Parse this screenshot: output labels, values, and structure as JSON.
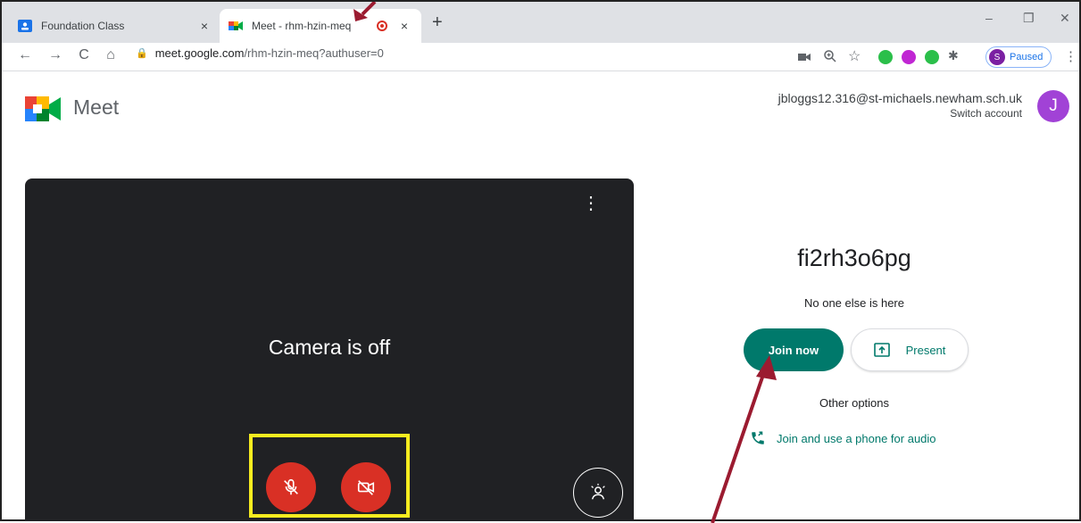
{
  "browser": {
    "tabs": [
      {
        "title": "Foundation Class",
        "close": "×"
      },
      {
        "title": "Meet - rhm-hzin-meq",
        "close": "×"
      }
    ],
    "new_tab": "+",
    "window_controls": {
      "minimize": "–",
      "restore": "❐",
      "close": "✕"
    },
    "nav": {
      "back": "←",
      "forward": "→",
      "reload": "C",
      "home": "⌂"
    },
    "url_host": "meet.google.com",
    "url_path": "/rhm-hzin-meq?authuser=0",
    "profile_initial": "S",
    "profile_status": "Paused",
    "menu": "⋮",
    "extension_colors": [
      "#2bbf4a",
      "#c026d3",
      "#2bbf4a"
    ]
  },
  "meet": {
    "app_name": "Meet",
    "account_email": "jbloggs12.316@st-michaels.newham.sch.uk",
    "switch_account": "Switch account",
    "avatar_initial": "J",
    "preview": {
      "status": "Camera is off",
      "more_options": "⋮"
    },
    "meeting_code": "fi2rh3o6pg",
    "participants_status": "No one else is here",
    "join_label": "Join now",
    "present_label": "Present",
    "other_options_label": "Other options",
    "phone_audio_label": "Join and use a phone for audio"
  },
  "colors": {
    "accent_teal": "#00796b",
    "mic_cam_off_red": "#d93025",
    "annotation_arrow": "#9b1b30",
    "highlight_yellow": "#f7ec1f",
    "preview_bg": "#202124"
  }
}
